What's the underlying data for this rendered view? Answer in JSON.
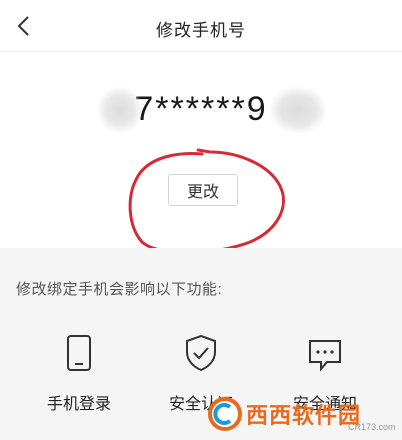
{
  "nav": {
    "title": "修改手机号"
  },
  "phone": {
    "masked_number": "7******9"
  },
  "actions": {
    "change_label": "更改"
  },
  "info": {
    "notice": "修改绑定手机会影响以下功能:"
  },
  "features": [
    {
      "label": "手机登录",
      "icon": "phone-icon"
    },
    {
      "label": "安全认证",
      "icon": "shield-check-icon"
    },
    {
      "label": "安全通知",
      "icon": "message-icon"
    }
  ],
  "watermark": {
    "brand": "西西软件园",
    "domain": "CR173.com"
  },
  "colors": {
    "annotation_red": "#d62a36",
    "watermark_orange": "#e86a1c",
    "section_gray": "#f5f5f5"
  }
}
